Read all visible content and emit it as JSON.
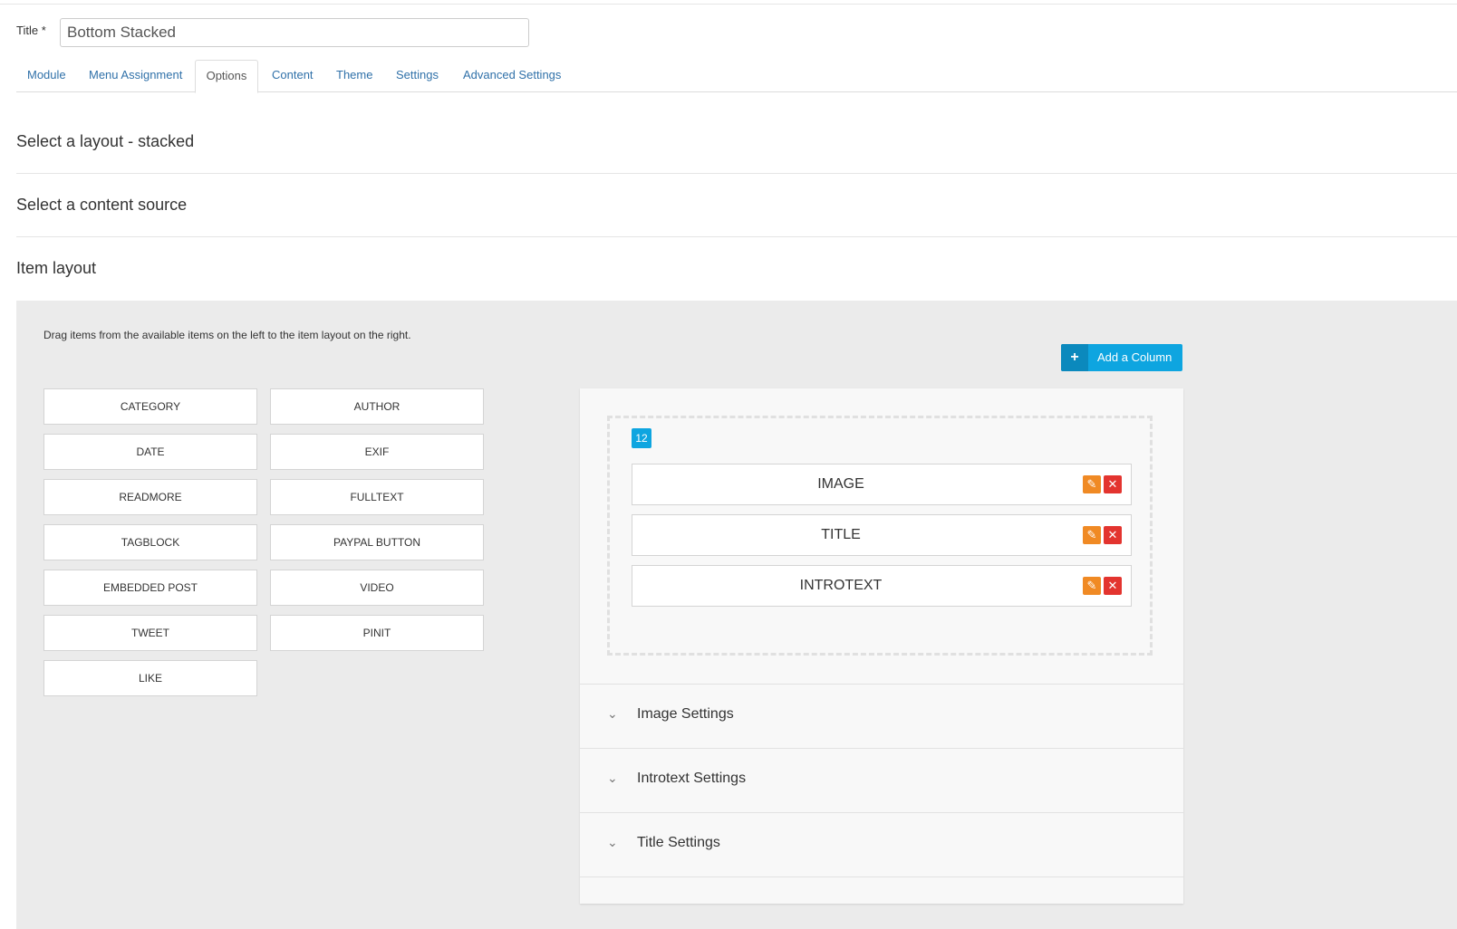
{
  "title_field": {
    "label": "Title *",
    "value": "Bottom Stacked"
  },
  "tabs": [
    {
      "label": "Module",
      "active": false
    },
    {
      "label": "Menu Assignment",
      "active": false
    },
    {
      "label": "Options",
      "active": true
    },
    {
      "label": "Content",
      "active": false
    },
    {
      "label": "Theme",
      "active": false
    },
    {
      "label": "Settings",
      "active": false
    },
    {
      "label": "Advanced Settings",
      "active": false
    }
  ],
  "sections": {
    "layout": "Select a layout - stacked",
    "source": "Select a content source",
    "item_layout": "Item layout"
  },
  "builder": {
    "hint": "Drag items from the available items on the left to the item layout on the right.",
    "add_column": {
      "icon": "plus-icon",
      "label": "Add a Column"
    },
    "available_items": [
      "CATEGORY",
      "AUTHOR",
      "DATE",
      "EXIF",
      "READMORE",
      "FULLTEXT",
      "TAGBLOCK",
      "PAYPAL BUTTON",
      "EMBEDDED POST",
      "VIDEO",
      "TWEET",
      "PINIT",
      "LIKE"
    ],
    "column": {
      "width_badge": "12",
      "items": [
        {
          "label": "IMAGE",
          "edit_icon": "pencil-icon",
          "remove_icon": "close-icon"
        },
        {
          "label": "TITLE",
          "edit_icon": "pencil-icon",
          "remove_icon": "close-icon"
        },
        {
          "label": "INTROTEXT",
          "edit_icon": "pencil-icon",
          "remove_icon": "close-icon"
        }
      ]
    },
    "accordions": [
      {
        "label": "Image Settings",
        "icon": "chevron-down-icon"
      },
      {
        "label": "Introtext Settings",
        "icon": "chevron-down-icon"
      },
      {
        "label": "Title Settings",
        "icon": "chevron-down-icon"
      }
    ]
  },
  "colors": {
    "accent": "#0ea5e0",
    "edit": "#f08a24",
    "remove": "#e3342f",
    "link": "#3071a9"
  }
}
